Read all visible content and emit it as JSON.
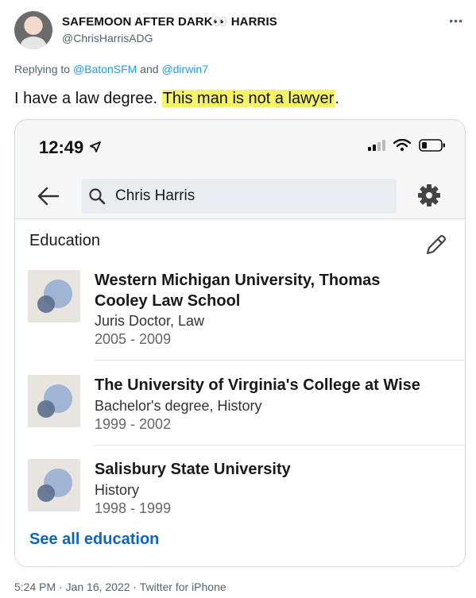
{
  "tweet": {
    "display_name": "SAFEMOON AFTER DARK👀 HARRIS",
    "handle": "@ChrisHarrisADG",
    "more_icon": "more-horizontal-icon",
    "replying_prefix": "Replying to ",
    "reply_user_1": "@BatonSFM",
    "reply_and": " and ",
    "reply_user_2": "@dirwin7",
    "text_plain": "I have a law degree. ",
    "text_highlight": "This man is not a lawyer",
    "text_end": ".",
    "highlight_color": "#f6f36a",
    "footer": "5:24 PM · Jan 16, 2022 · Twitter for iPhone"
  },
  "phone": {
    "time": "12:49",
    "search_query": "Chris Harris",
    "section_title": "Education",
    "see_all": "See all education",
    "accent": "#0a66c2",
    "entries": [
      {
        "school_line1": "Western Michigan University, Thomas",
        "school_line2": "Cooley Law School",
        "degree": "Juris Doctor, Law",
        "years": "2005 - 2009"
      },
      {
        "school_line1": "The University of Virginia's College at Wise",
        "school_line2": "",
        "degree": "Bachelor's degree, History",
        "years": "1999 - 2002"
      },
      {
        "school_line1": "Salisbury State University",
        "school_line2": "",
        "degree": "History",
        "years": "1998 - 1999"
      }
    ]
  }
}
